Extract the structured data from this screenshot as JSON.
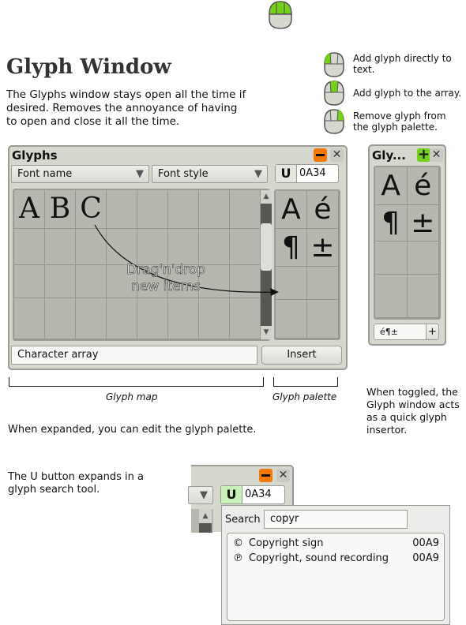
{
  "heading": "Glyph Window",
  "intro": "The Glyphs window stays open all the time if desired. Removes the annoyance of having to open and close it all the time.",
  "mouse_legend": [
    {
      "icon": "mouse-left-click-icon",
      "text": "Add glyph directly to text."
    },
    {
      "icon": "mouse-middle-click-icon",
      "text": "Add glyph to the array."
    },
    {
      "icon": "mouse-right-click-icon",
      "text": "Remove glyph from the glyph palette."
    }
  ],
  "main_window": {
    "title": "Glyphs",
    "font_name": "Font name",
    "font_style": "Font style",
    "u_label": "U",
    "codepoint": "0A34",
    "map_glyphs": [
      "A",
      "B",
      "C"
    ],
    "palette_glyphs": [
      "A",
      "é",
      "¶",
      "±"
    ],
    "drag_hint": "Drag'n'drop new items",
    "char_array": "Character array",
    "insert_label": "Insert"
  },
  "labels": {
    "glyph_map": "Glyph map",
    "glyph_palette": "Glyph palette"
  },
  "expanded_note": "When expanded, you can edit the glyph palette.",
  "toggled_window": {
    "title": "Gly...",
    "palette_glyphs": [
      "A",
      "é",
      "¶",
      "±"
    ],
    "array_value": "é¶±",
    "add_label": "+"
  },
  "toggled_note": "When toggled, the Glyph window acts as a quick glyph insertor.",
  "u_note": "The U button expands in a glyph search tool.",
  "search_tool": {
    "u_label": "U",
    "codepoint": "0A34",
    "search_label": "Search",
    "query": "copyr",
    "results": [
      {
        "symbol": "©",
        "name": "Copyright sign",
        "code": "00A9"
      },
      {
        "symbol": "℗",
        "name": "Copyright, sound recording",
        "code": "00A9"
      }
    ]
  },
  "colors": {
    "accent_green": "#73d216",
    "minimize_orange": "#f57900",
    "window_bg": "#d6d8d0",
    "grid_bg": "#b6b8b0"
  }
}
